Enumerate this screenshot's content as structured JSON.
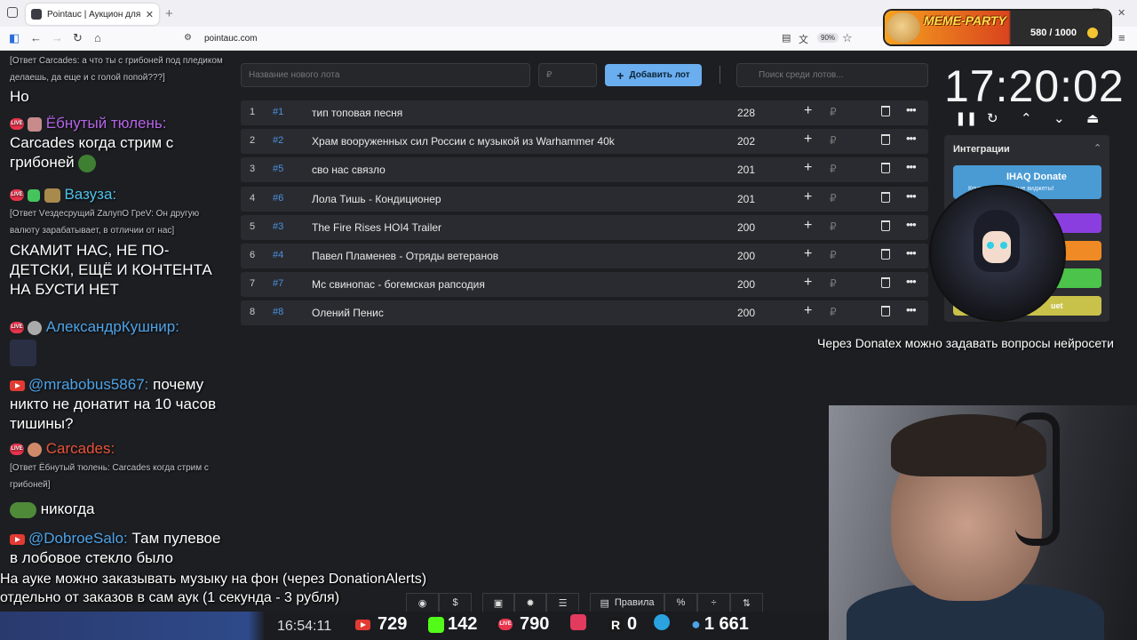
{
  "browser": {
    "tab_title": "Pointauc | Аукцион для стрима",
    "url": "pointauc.com",
    "zoom": "90%"
  },
  "meme": {
    "title": "MEME-PARTY",
    "score": "580 / 1000"
  },
  "chat": {
    "m1_reply": "[Ответ Carcades: а что ты с грибоней под пледиком делаешь, да еще и с голой попой???]",
    "m1_text": "Но",
    "m2_name": "Ёбнутый тюлень:",
    "m2_text": "Carcades когда стрим с грибоней",
    "m3_name": "Вазуза:",
    "m3_reply": "[Ответ Vездесрущий ZалупО ГреV: Он другую валюту зарабатывает, в отличии от нас]",
    "m3_text": "СКАМИТ НАС, НЕ ПО-ДЕТСКИ, ЕЩЁ И КОНТЕНТА НА БУСТИ НЕТ",
    "m4_name": "АлександрКушнир:",
    "m5_name": "@mrabobus5867:",
    "m5_text": "почему никто не донатит на 10 часов тишины?",
    "m6_name": "Carcades:",
    "m6_reply": "[Ответ Ёбнутый тюлень: Carcades когда стрим с грибоней]",
    "m6_text": "никогда",
    "m7_name": "@DobroeSalo:",
    "m7_text": "Там пулевое в лобовое стекло было"
  },
  "form": {
    "lot_placeholder": "Название нового лота",
    "amount_placeholder": "₽",
    "add_label": "Добавить лот",
    "search_placeholder": "Поиск среди лотов..."
  },
  "lots": [
    {
      "n": "1",
      "id": "#1",
      "name": "тип топовая песня",
      "amount": "228"
    },
    {
      "n": "2",
      "id": "#2",
      "name": "Храм вооруженных сил России с музыкой из Warhammer 40k",
      "amount": "202"
    },
    {
      "n": "3",
      "id": "#5",
      "name": "сво нас связло",
      "amount": "201"
    },
    {
      "n": "4",
      "id": "#6",
      "name": "Лола Тишь - Кондиционер",
      "amount": "201"
    },
    {
      "n": "5",
      "id": "#3",
      "name": "The Fire Rises HOI4 Trailer",
      "amount": "200"
    },
    {
      "n": "6",
      "id": "#4",
      "name": "Павел Пламенев - Отряды ветеранов",
      "amount": "200"
    },
    {
      "n": "7",
      "id": "#7",
      "name": "Мс свинопас - богемская рапсодия",
      "amount": "200"
    },
    {
      "n": "8",
      "id": "#8",
      "name": "Олений Пенис",
      "amount": "200"
    }
  ],
  "timer": "17:20:02",
  "integrations": {
    "title": "Интеграции",
    "donate_title": "IHAQ Donate",
    "donate_sub": "Крутые уникальные виджеты!",
    "bouquet": "uet"
  },
  "donatex_text": "Через Donatex можно задавать вопросы нейросети",
  "notes": {
    "line1": "На ауке можно заказывать музыку на фон (через DonationAlerts)",
    "line2": "отдельно от заказов в сам аук (1 секунда - 3 рубля)"
  },
  "bottom": {
    "rules_label": "Правила",
    "percent_label": "%",
    "clock": "16:54:11",
    "yt_count": "729",
    "kick_count": "142",
    "live_count": "790",
    "r_count": "0",
    "viewers": "1 661"
  }
}
